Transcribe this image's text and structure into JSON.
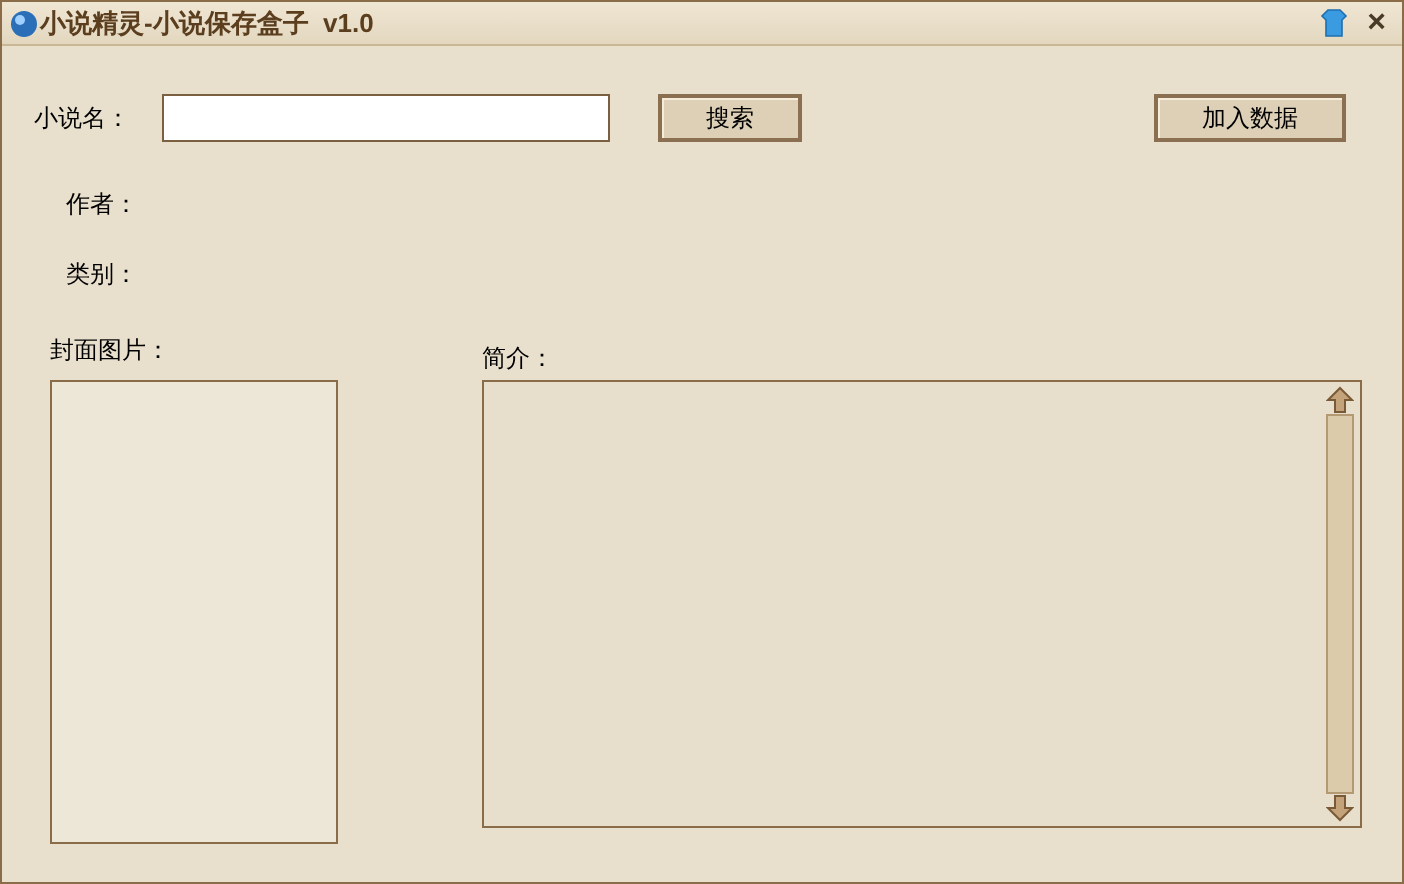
{
  "window": {
    "title": "小说精灵-小说保存盒子  v1.0",
    "close": "×"
  },
  "search": {
    "label": "小说名：",
    "button": "搜索"
  },
  "add_button": "加入数据",
  "author": {
    "label": "作者："
  },
  "category": {
    "label": "类别："
  },
  "cover": {
    "label": "封面图片："
  },
  "summary": {
    "label": "简介："
  }
}
